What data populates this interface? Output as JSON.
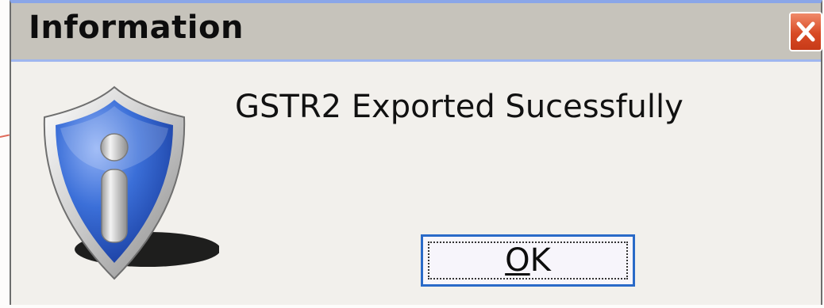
{
  "dialog": {
    "title": "Information",
    "message": "GSTR2 Exported Sucessfully",
    "ok_button": {
      "label_mnemonic": "O",
      "label_rest": "K"
    },
    "icons": {
      "close": "close-icon",
      "info": "information-shield-icon"
    },
    "colors": {
      "titlebar": "#c6c3bb",
      "titlebar_accent": "#9fb6ef",
      "close_button": "#d84a25",
      "shield_blue": "#2f5fc9",
      "ok_border": "#2a6ac8"
    }
  }
}
